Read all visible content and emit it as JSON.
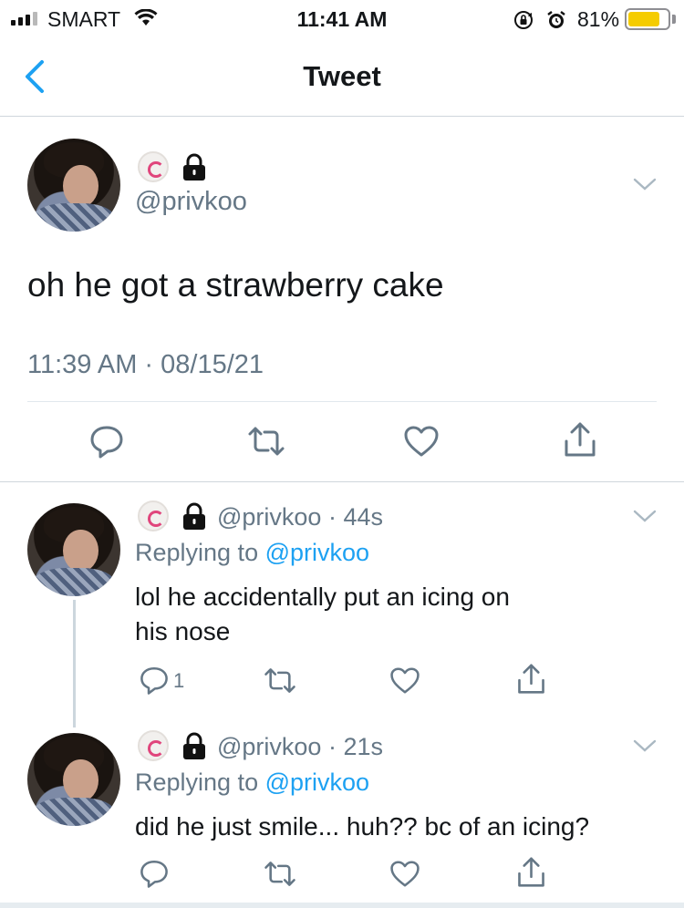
{
  "status_bar": {
    "carrier": "SMART",
    "time": "11:41 AM",
    "battery_percent": "81%",
    "battery_level": 0.81,
    "battery_color": "#f5cc00"
  },
  "nav": {
    "title": "Tweet",
    "back_icon": "chevron-left-icon",
    "accent": "#1da1f2"
  },
  "main_tweet": {
    "handle": "@privkoo",
    "text": "oh he got a strawberry cake",
    "timestamp": "11:39 AM · 08/15/21"
  },
  "replies": [
    {
      "handle": "@privkoo",
      "age": "· 44s",
      "replying_prefix": "Replying to",
      "replying_to": "@privkoo",
      "text_lines": [
        "lol he accidentally put an icing on",
        "his nose"
      ],
      "reply_count": "1"
    },
    {
      "handle": "@privkoo",
      "age": "· 21s",
      "replying_prefix": "Replying to",
      "replying_to": "@privkoo",
      "text_lines": [
        "did he just smile... huh?? bc of an icing?"
      ]
    }
  ]
}
